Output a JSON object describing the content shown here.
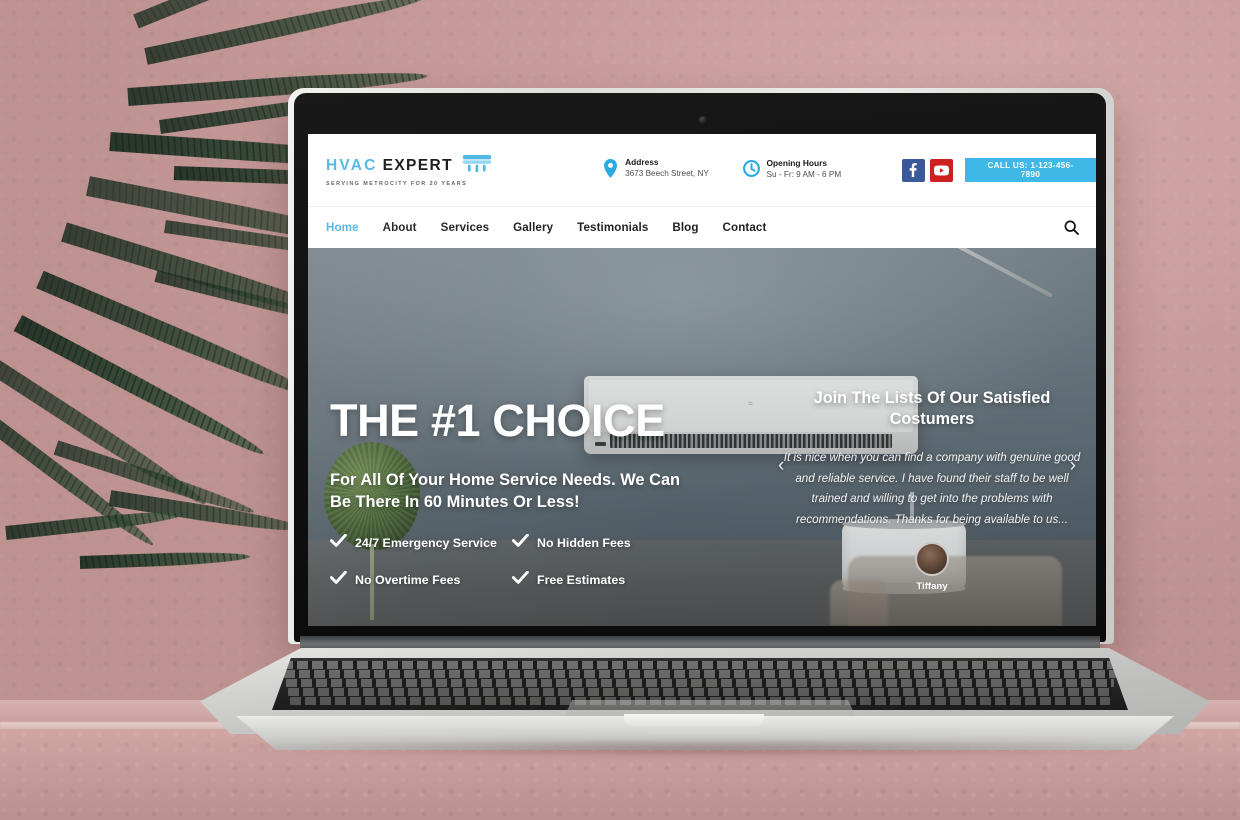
{
  "site": {
    "logo": {
      "primary": "HVAC",
      "secondary": "EXPERT",
      "tagline": "SERVING METROCITY FOR 20 YEARS",
      "mark_icon": "ac-unit-icon"
    },
    "header": {
      "address": {
        "icon": "map-pin-icon",
        "title": "Address",
        "text": "3673 Beech Street, NY"
      },
      "hours": {
        "icon": "clock-icon",
        "title": "Opening Hours",
        "text": "Su - Fr: 9 AM - 6 PM"
      },
      "social": [
        {
          "name": "facebook-icon",
          "label": "f",
          "color": "#3b5998"
        },
        {
          "name": "youtube-icon",
          "label": "▶",
          "color": "#cd201f"
        }
      ],
      "call_button": {
        "label": "CALL US: 1-123-456-7890",
        "color": "#3fb8e8"
      }
    },
    "nav": {
      "items": [
        {
          "label": "Home",
          "active": true
        },
        {
          "label": "About",
          "active": false
        },
        {
          "label": "Services",
          "active": false
        },
        {
          "label": "Gallery",
          "active": false
        },
        {
          "label": "Testimonials",
          "active": false
        },
        {
          "label": "Blog",
          "active": false
        },
        {
          "label": "Contact",
          "active": false
        }
      ],
      "search_icon": "search-icon",
      "active_color": "#49b5e4"
    },
    "hero": {
      "headline": "THE #1 CHOICE",
      "subheadline": "For All Of Your Home Service Needs. We Can Be There In 60 Minutes Or Less!",
      "features": [
        "24/7 Emergency Service",
        "No Hidden Fees",
        "No Overtime Fees",
        "Free Estimates"
      ],
      "ac_logo_text": "≈"
    },
    "testimonial": {
      "title": "Join The Lists Of Our Satisfied Costumers",
      "quote": "It is nice when you can find a company with genuine good and reliable service. I have found their staff to be well trained and willing to get into the problems with recommendations. Thanks for being available to us...",
      "author": "Tiffany",
      "prev_icon": "chevron-left-icon",
      "next_icon": "chevron-right-icon",
      "prev_glyph": "‹",
      "next_glyph": "›"
    }
  }
}
